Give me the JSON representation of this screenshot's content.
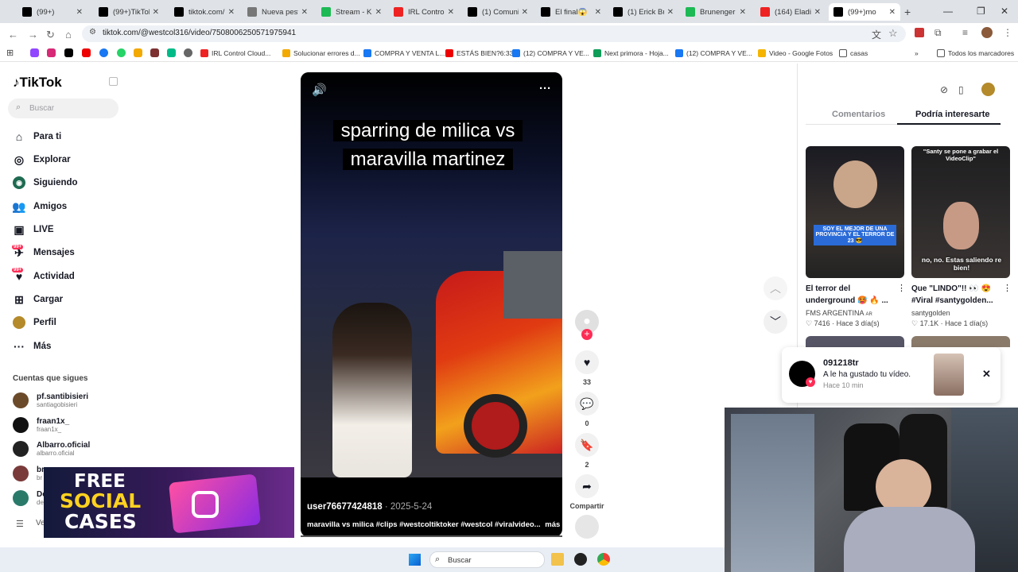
{
  "tabs": [
    {
      "label": "(99+)",
      "fav_color": "#000"
    },
    {
      "label": "(99+)TikTok",
      "fav_color": "#000"
    },
    {
      "label": "tiktok.com/@",
      "fav_color": "#000"
    },
    {
      "label": "Nueva pesta",
      "fav_color": "#777"
    },
    {
      "label": "Stream - Kick",
      "fav_color": "#1db954"
    },
    {
      "label": "IRL Control",
      "fav_color": "#e22"
    },
    {
      "label": "(1) Comunic",
      "fav_color": "#000"
    },
    {
      "label": "El final😱",
      "fav_color": "#000"
    },
    {
      "label": "(1) Erick Buil",
      "fav_color": "#000"
    },
    {
      "label": "Brunenger",
      "fav_color": "#1db954"
    },
    {
      "label": "(164) Eladio",
      "fav_color": "#e22"
    },
    {
      "label": "(99+)mo",
      "fav_color": "#000"
    }
  ],
  "url": "tiktok.com/@westcol316/video/7508006250571975941",
  "bookmarks": [
    "IRL Control Cloud...",
    "Solucionar errores d...",
    "COMPRA Y VENTA L...",
    "ESTÁS BIEN?6:33",
    "(12) COMPRA Y VE...",
    "Next primora - Hoja...",
    "(12) COMPRA Y VE...",
    "Video - Google Fotos",
    "casas"
  ],
  "bookmarks_all": "Todos los marcadores",
  "sidebar": {
    "logo": "TikTok",
    "search_placeholder": "Buscar",
    "nav": [
      "Para ti",
      "Explorar",
      "Siguiendo",
      "Amigos",
      "LIVE",
      "Mensajes",
      "Actividad",
      "Cargar",
      "Perfil",
      "Más"
    ],
    "badge": "99+",
    "following_header": "Cuentas que sigues",
    "accounts": [
      {
        "name": "pf.santibisieri",
        "handle": "santiagobisieri"
      },
      {
        "name": "fraan1x_",
        "handle": "fraan1x_"
      },
      {
        "name": "Albarro.oficial",
        "handle": "albarro.oficial"
      },
      {
        "name": "br",
        "handle": "br"
      },
      {
        "name": "De",
        "handle": "de"
      }
    ],
    "see_more": "Ve"
  },
  "ad": {
    "line1": "FREE",
    "line2": "SOCIAL",
    "line3": "CASES"
  },
  "video": {
    "caption_line1": "sparring de milica vs",
    "caption_line2": "maravilla martinez",
    "user": "user76677424818",
    "date": "· 2025-5-24",
    "description": "maravilla vs milica #clips #westcoltiktoker #westcol #viralvideo...",
    "more": "más"
  },
  "actions": {
    "likes": "33",
    "comments": "0",
    "saves": "2",
    "share": "Compartir"
  },
  "right_panel": {
    "tabs": [
      "Comentarios",
      "Podría interesarte"
    ],
    "cards": [
      {
        "title": "El terror del underground 🥵 🔥 ...",
        "author": "FMS ARGENTINA",
        "author_badge": "AR",
        "likes": "7416",
        "time": "Hace 3 día(s)",
        "overlay": "SOY EL MEJOR DE UNA PROVINCIA Y EL TERROR DE 23 😎"
      },
      {
        "title": "Que \"LINDO\"!! 👀 😍 #Viral #santygolden...",
        "author": "santygolden",
        "likes": "17.1K",
        "time": "Hace 1 día(s)",
        "overlay_top": "\"Santy se pone a grabar el VideoClip\"",
        "overlay": "no, no. Estas saliendo re bien!"
      }
    ]
  },
  "notification": {
    "user": "091218tr",
    "text": "A le ha gustado tu vídeo.",
    "time": "Hace 10 min"
  },
  "taskbar": {
    "search": "Buscar"
  }
}
